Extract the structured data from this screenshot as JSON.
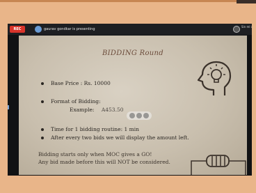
{
  "meeting": {
    "rec_label": "REC",
    "presenting_text": "gaurav gondkar is presenting",
    "side_label": "Sin ml and n"
  },
  "slide": {
    "title": "BIDDING Round",
    "bullets": {
      "base_price": "Base Price : Rs. 10000",
      "format": "Format of Bidding:",
      "example_label": "Example:",
      "example_amount": "A453.50",
      "time": "Time for 1 bidding routine: 1 min",
      "after": "After every two bids we will display the amount left."
    },
    "notes": [
      "Bidding starts only when MOC gives a GO!",
      "Any bid made before this will NOT be considered."
    ]
  },
  "colors": {
    "page_background": "#e9b589",
    "recording_red": "#d9342b",
    "title_brown": "#6b4b3a"
  },
  "icons": [
    "head-lightbulb-icon",
    "resistor-icon"
  ]
}
